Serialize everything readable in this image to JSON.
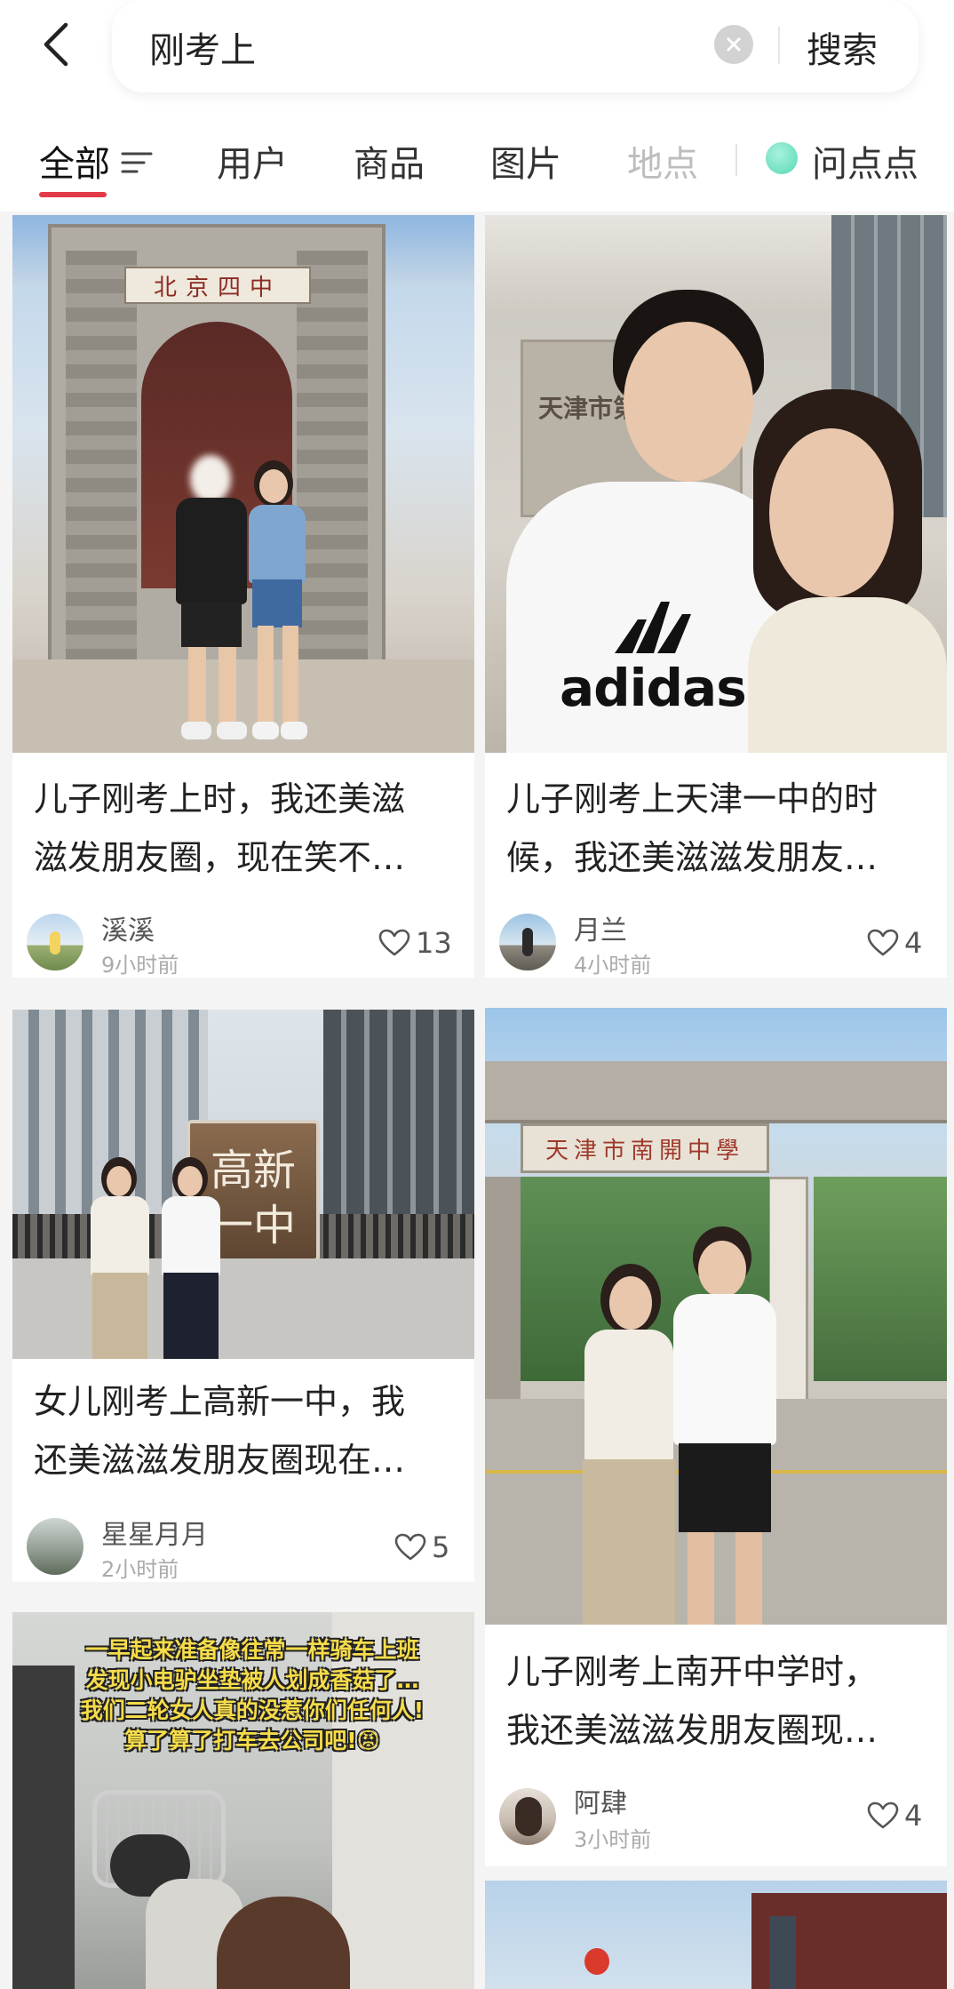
{
  "search": {
    "query": "刚考上",
    "button_label": "搜索"
  },
  "tabs": [
    {
      "label": "全部"
    },
    {
      "label": "用户"
    },
    {
      "label": "商品"
    },
    {
      "label": "图片"
    },
    {
      "label": "地点"
    },
    {
      "label": "问点点"
    }
  ],
  "cards": [
    {
      "photo_text": "北京四中",
      "title_line1": "儿子刚考上时，我还美滋",
      "title_line2": "滋发朋友圈，现在笑不…",
      "author": "溪溪",
      "time": "9小时前",
      "likes": "13"
    },
    {
      "photo_text": "天津市第一中学",
      "shirt_text": "adidas",
      "title_line1": "儿子刚考上天津一中的时",
      "title_line2": "候，我还美滋滋发朋友…",
      "author": "月兰",
      "time": "4小时前",
      "likes": "4"
    },
    {
      "photo_text": "高新一中",
      "title_line1": "女儿刚考上高新一中，我",
      "title_line2": "还美滋滋发朋友圈现在…",
      "author": "星星月月",
      "time": "2小时前",
      "likes": "5"
    },
    {
      "photo_text": "天津市南開中學",
      "title_line1": "儿子刚考上南开中学时，",
      "title_line2": "我还美滋滋发朋友圈现…",
      "author": "阿肆",
      "time": "3小时前",
      "likes": "4"
    },
    {
      "caption_line1": "一早起来准备像往常一样骑车上班",
      "caption_line2": "发现小电驴坐垫被人划成香菇了…",
      "caption_line3": "我们二轮女人真的没惹你们任何人!",
      "caption_line4": "算了算了打车去公司吧!😡"
    },
    {}
  ]
}
